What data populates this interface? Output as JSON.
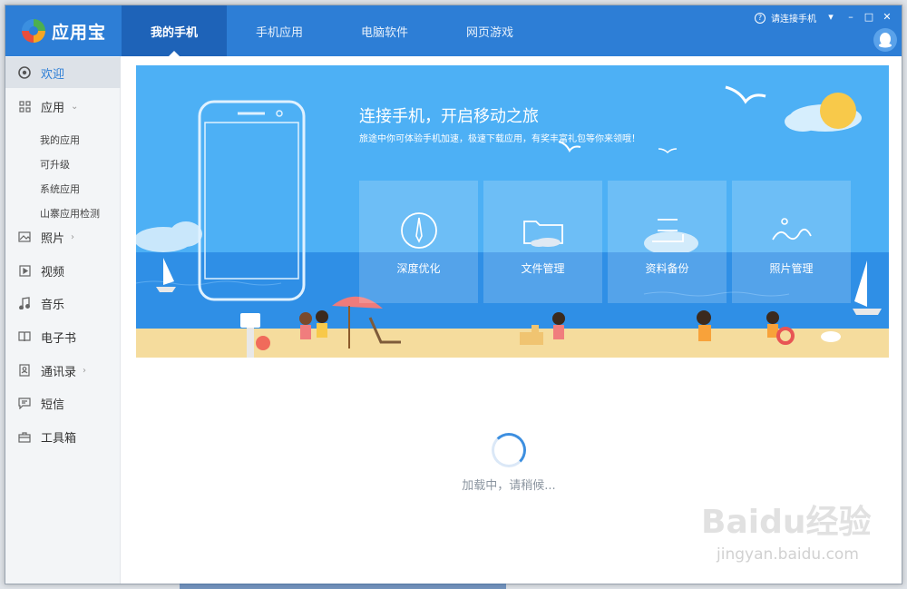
{
  "app": {
    "name": "应用宝"
  },
  "header": {
    "tabs": [
      {
        "label": "我的手机",
        "active": true
      },
      {
        "label": "手机应用",
        "active": false
      },
      {
        "label": "电脑软件",
        "active": false
      },
      {
        "label": "网页游戏",
        "active": false
      }
    ],
    "connect_label": "请连接手机",
    "help_symbol": "?",
    "controls": {
      "menu": "▾",
      "minimize": "–",
      "maximize": "□",
      "close": "✕"
    }
  },
  "sidebar": {
    "items": [
      {
        "label": "欢迎",
        "icon": "welcome-icon",
        "active": true
      },
      {
        "label": "应用",
        "icon": "grid-icon",
        "arrow": "⌄"
      },
      {
        "label": "照片",
        "icon": "photo-icon",
        "arrow": "›"
      },
      {
        "label": "视频",
        "icon": "video-icon"
      },
      {
        "label": "音乐",
        "icon": "music-icon"
      },
      {
        "label": "电子书",
        "icon": "book-icon"
      },
      {
        "label": "通讯录",
        "icon": "contacts-icon",
        "arrow": "›"
      },
      {
        "label": "短信",
        "icon": "sms-icon"
      },
      {
        "label": "工具箱",
        "icon": "toolbox-icon"
      }
    ],
    "app_subitems": [
      "我的应用",
      "可升级",
      "系统应用",
      "山寨应用检测"
    ]
  },
  "banner": {
    "title": "连接手机，开启移动之旅",
    "subtitle": "旅途中你可体验手机加速，极速下载应用，有奖丰富礼包等你来领哦！",
    "tiles": [
      {
        "label": "深度优化",
        "icon": "compass-icon"
      },
      {
        "label": "文件管理",
        "icon": "folder-icon"
      },
      {
        "label": "资料备份",
        "icon": "backup-icon"
      },
      {
        "label": "照片管理",
        "icon": "photo-manage-icon"
      }
    ]
  },
  "loading": {
    "text": "加载中，请稍候..."
  },
  "watermark": {
    "brand": "Baidu经验",
    "url": "jingyan.baidu.com"
  },
  "colors": {
    "header": "#2d7ed6",
    "tab_active": "#1e63b8",
    "banner_sky": "#4db0f5",
    "banner_sea": "#2f8fe6",
    "sand": "#f5dc9d",
    "accent": "#3d8fe0"
  }
}
